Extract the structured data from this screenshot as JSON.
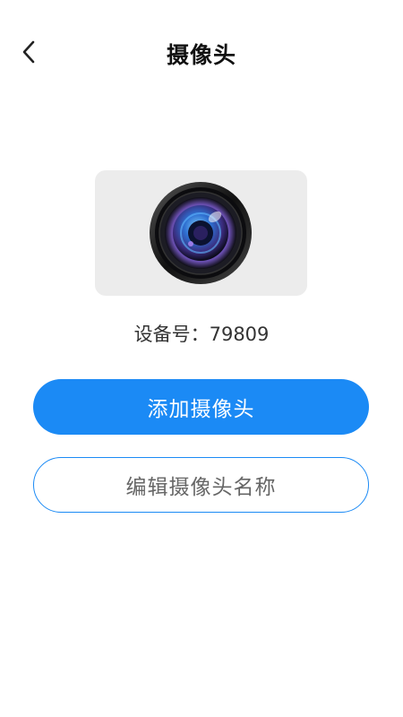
{
  "header": {
    "back_icon": "chevron-left-icon",
    "title": "摄像头"
  },
  "camera": {
    "image_icon": "camera-lens-icon"
  },
  "device": {
    "label": "设备号：",
    "number": "79809"
  },
  "actions": {
    "add_camera_label": "添加摄像头",
    "edit_name_label": "编辑摄像头名称"
  },
  "colors": {
    "accent": "#1b8af5",
    "card_bg": "#ececec"
  }
}
